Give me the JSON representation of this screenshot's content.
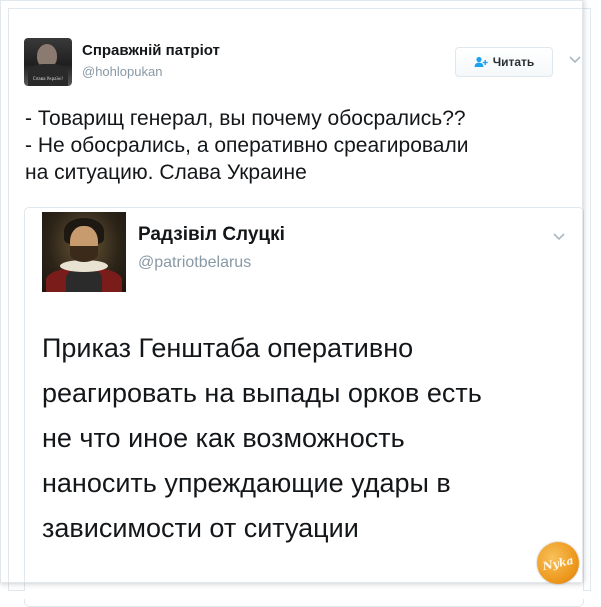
{
  "tweet": {
    "author": {
      "name": "Справжній патріот",
      "handle": "@hohlopukan",
      "avatar_caption": "Слава Україні!",
      "avatar_icon": "profile-photo"
    },
    "follow_button": {
      "label": "Читать",
      "icon": "add-user-icon"
    },
    "menu_icon": "chevron-down-icon",
    "text_lines": [
      "- Товарищ генерал, вы почему обосрались??",
      "- Не обосрались, а оперативно среагировали",
      "на ситуацию. Слава Украине"
    ]
  },
  "quoted_tweet": {
    "author": {
      "name": "Радзівіл Слуцкі",
      "handle": "@patriotbelarus",
      "avatar_icon": "portrait-painting"
    },
    "menu_icon": "chevron-down-icon",
    "text_lines": [
      "Приказ Генштаба оперативно",
      "реагировать на выпады орков есть",
      "не что иное как возможность",
      "наносить упреждающие удары в",
      "зависимости от ситуации"
    ]
  },
  "watermark": {
    "label": "Nyka",
    "colors": {
      "fill": "#ee9a1f",
      "text": "#fff7e6"
    }
  },
  "colors": {
    "text": "#14171a",
    "muted": "#8899a6",
    "border": "#e1e8ed",
    "accent": "#1da1f2"
  }
}
